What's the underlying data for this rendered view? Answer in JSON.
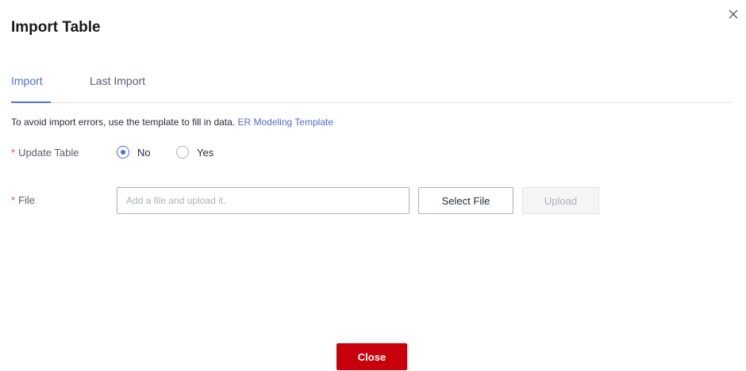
{
  "dialog": {
    "title": "Import Table",
    "close_icon": "close-icon"
  },
  "tabs": [
    {
      "label": "Import",
      "active": true
    },
    {
      "label": "Last Import",
      "active": false
    }
  ],
  "hint": {
    "text": "To avoid import errors, use the template to fill in data.",
    "link_label": "ER Modeling Template"
  },
  "form": {
    "required_mark": "*",
    "update_table": {
      "label": "Update Table",
      "options": [
        {
          "label": "No",
          "checked": true
        },
        {
          "label": "Yes",
          "checked": false
        }
      ]
    },
    "file": {
      "label": "File",
      "value": "",
      "placeholder": "Add a file and upload it.",
      "select_label": "Select File",
      "upload_label": "Upload",
      "upload_disabled": true
    }
  },
  "footer": {
    "close_label": "Close"
  },
  "colors": {
    "accent": "#526ecc",
    "required": "#e54545",
    "primary_button": "#c7000b"
  }
}
